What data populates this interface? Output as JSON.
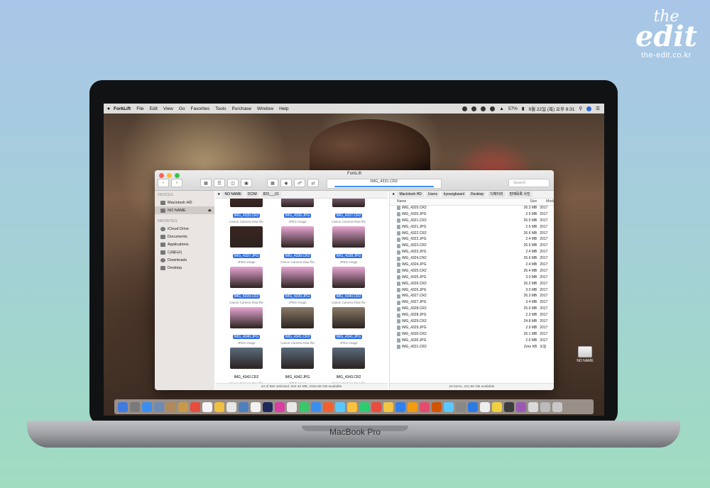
{
  "brand": {
    "line1": "the",
    "line2": "edit",
    "url": "the-edit.co.kr"
  },
  "menubar": {
    "items": [
      "ForkLift",
      "File",
      "Edit",
      "View",
      "Go",
      "Favorites",
      "Tools",
      "Purchase",
      "Window",
      "Help"
    ],
    "battery": "57%",
    "clock": "9월 22일 (목) 오후 8:31"
  },
  "window": {
    "title": "ForkLift",
    "path_field": "IMG_4331.CR2",
    "search_placeholder": "Search",
    "sidebar": {
      "devices_header": "DEVICES",
      "devices": [
        "Macintosh HD",
        "NO NAME"
      ],
      "favorites_header": "FAVORITES",
      "favorites": [
        "iCloud Drive",
        "Documents",
        "Applications",
        "디렉터리",
        "Downloads",
        "Desktop"
      ]
    },
    "left_pane": {
      "breadcrumbs": [
        "NO NAME",
        "DCIM",
        "823___01"
      ],
      "items": [
        {
          "name": "IMG_4335.CR2",
          "kind": "Canon Camera Raw file",
          "selected": true
        },
        {
          "name": "IMG_4336.JPG",
          "kind": "JPEG image",
          "selected": true
        },
        {
          "name": "IMG_4337.CR2",
          "kind": "Canon Camera Raw file",
          "selected": true
        },
        {
          "name": "IMG_4337.JPG",
          "kind": "JPEG image",
          "selected": true
        },
        {
          "name": "IMG_4338.CR2",
          "kind": "Canon Camera Raw file",
          "selected": true
        },
        {
          "name": "IMG_4338.JPG",
          "kind": "JPEG image",
          "selected": true
        },
        {
          "name": "IMG_4339.CR2",
          "kind": "Canon Camera Raw file",
          "selected": true
        },
        {
          "name": "IMG_4339.JPG",
          "kind": "JPEG image",
          "selected": true
        },
        {
          "name": "IMG_4340.CR2",
          "kind": "Canon Camera Raw file",
          "selected": true
        },
        {
          "name": "IMG_4340.JPG",
          "kind": "JPEG image",
          "selected": true
        },
        {
          "name": "IMG_4341.CR2",
          "kind": "Canon Camera Raw file",
          "selected": true
        },
        {
          "name": "IMG_4341.JPG",
          "kind": "JPEG image",
          "selected": true
        },
        {
          "name": "IMG_4342.CR2",
          "kind": "Canon Camera Raw file",
          "selected": false
        },
        {
          "name": "IMG_4342.JPG",
          "kind": "JPEG image",
          "selected": false
        },
        {
          "name": "IMG_4343.CR2",
          "kind": "Canon Camera Raw file",
          "selected": false
        }
      ],
      "status": "44 of 862 selected, 824.32 MB, 1534.66 GB available"
    },
    "right_pane": {
      "breadcrumbs": [
        "Macintosh HD",
        "Users",
        "kyoungkwanl",
        "Desktop",
        "디렉터리",
        "판매목록 사진"
      ],
      "columns": {
        "name": "Name",
        "size": "Size",
        "modified": "Modi"
      },
      "rows": [
        {
          "name": "IMG_4320.CR2",
          "size": "26.3 MB",
          "modified": "2017"
        },
        {
          "name": "IMG_4320.JPG",
          "size": "2.5 MB",
          "modified": "2017"
        },
        {
          "name": "IMG_4321.CR2",
          "size": "26.5 MB",
          "modified": "2017"
        },
        {
          "name": "IMG_4321.JPG",
          "size": "2.5 MB",
          "modified": "2017"
        },
        {
          "name": "IMG_4322.CR2",
          "size": "26.6 MB",
          "modified": "2017"
        },
        {
          "name": "IMG_4322.JPG",
          "size": "2.4 MB",
          "modified": "2017"
        },
        {
          "name": "IMG_4323.CR2",
          "size": "26.5 MB",
          "modified": "2017"
        },
        {
          "name": "IMG_4323.JPG",
          "size": "2.4 MB",
          "modified": "2017"
        },
        {
          "name": "IMG_4324.CR2",
          "size": "26.6 MB",
          "modified": "2017"
        },
        {
          "name": "IMG_4324.JPG",
          "size": "2.4 MB",
          "modified": "2017"
        },
        {
          "name": "IMG_4325.CR2",
          "size": "26.4 MB",
          "modified": "2017"
        },
        {
          "name": "IMG_4325.JPG",
          "size": "3.0 MB",
          "modified": "2017"
        },
        {
          "name": "IMG_4326.CR2",
          "size": "26.2 MB",
          "modified": "2017"
        },
        {
          "name": "IMG_4326.JPG",
          "size": "3.0 MB",
          "modified": "2017"
        },
        {
          "name": "IMG_4327.CR2",
          "size": "26.3 MB",
          "modified": "2017"
        },
        {
          "name": "IMG_4327.JPG",
          "size": "3.4 MB",
          "modified": "2017"
        },
        {
          "name": "IMG_4328.CR2",
          "size": "25.6 MB",
          "modified": "2017"
        },
        {
          "name": "IMG_4328.JPG",
          "size": "2.3 MB",
          "modified": "2017"
        },
        {
          "name": "IMG_4329.CR2",
          "size": "24.8 MB",
          "modified": "2017"
        },
        {
          "name": "IMG_4329.JPG",
          "size": "2.9 MB",
          "modified": "2017"
        },
        {
          "name": "IMG_4330.CR2",
          "size": "26.1 MB",
          "modified": "2017"
        },
        {
          "name": "IMG_4330.JPG",
          "size": "2.6 MB",
          "modified": "2017"
        },
        {
          "name": "IMG_4331.CR2",
          "size": "Zero KB",
          "modified": "오늘"
        }
      ],
      "status": "23 items, 241.55 GB available"
    }
  },
  "desktop_disk_label": "NO NAME",
  "laptop_label": "MacBook Pro",
  "colors": {
    "selection": "#2f6fe0",
    "progress": "#3a8ef0"
  }
}
